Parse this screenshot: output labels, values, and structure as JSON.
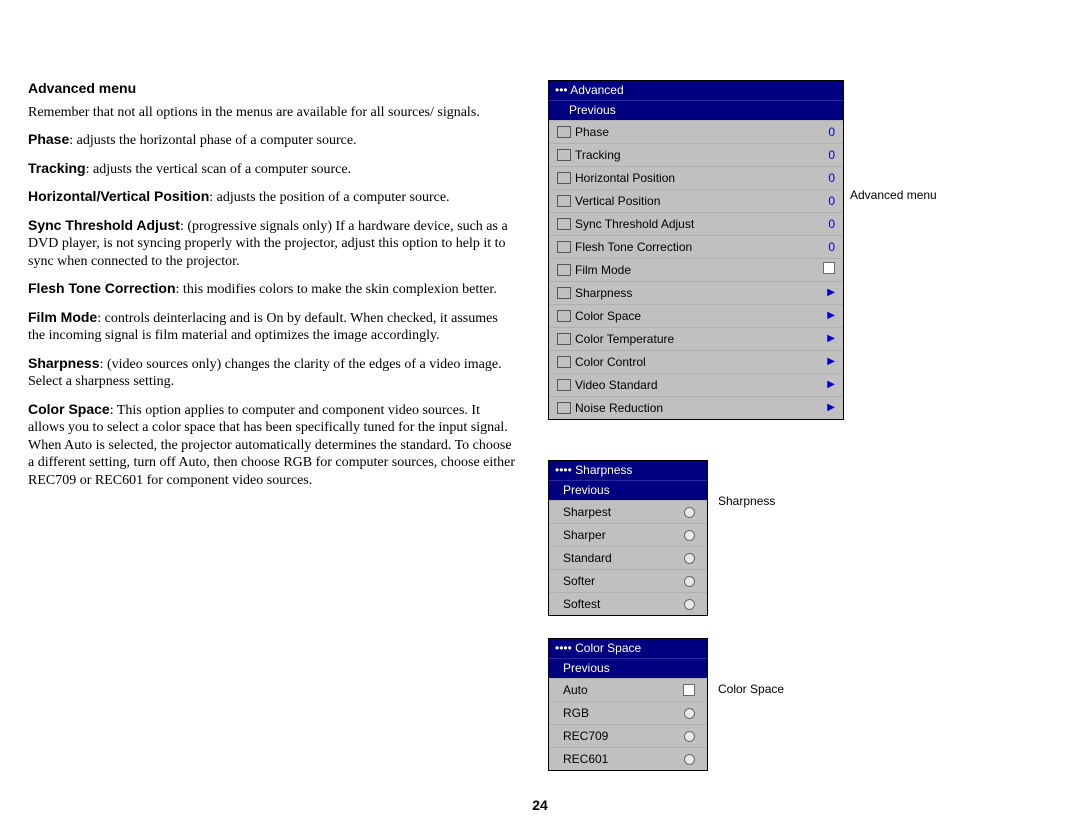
{
  "heading": "Advanced menu",
  "intro": "Remember that not all options in the menus are available for all sources/ signals.",
  "paras": [
    {
      "term": "Phase",
      "text": ": adjusts the horizontal phase of a computer source."
    },
    {
      "term": "Tracking",
      "text": ": adjusts the vertical scan of a computer source."
    },
    {
      "term": "Horizontal/Vertical Position",
      "text": ": adjusts the position of a computer source."
    },
    {
      "term": "Sync Threshold Adjust",
      "text": ": (progressive signals only) If a hardware device, such as a DVD player, is not syncing properly with the projector, adjust this option to help it to sync when connected to the projector."
    },
    {
      "term": "Flesh Tone Correction",
      "text": ": this modifies colors to make the skin complexion better."
    },
    {
      "term": "Film Mode",
      "text": ": controls deinterlacing and is On by default. When checked, it assumes the incoming signal is film material and optimizes the image accordingly."
    },
    {
      "term": "Sharpness",
      "text": ": (video sources only) changes the clarity of the edges of a video image. Select a sharpness setting."
    },
    {
      "term": "Color Space",
      "text": ": This option applies to computer and component video sources. It allows you to select a color space that has been specifically tuned for the input signal. When Auto is selected, the projector automatically determines the standard. To choose a different setting, turn off Auto, then choose RGB for computer sources, choose either REC709 or REC601 for component video sources."
    }
  ],
  "page_number": "24",
  "captions": {
    "adv": "Advanced menu",
    "sharp": "Sharpness",
    "cspace": "Color Space"
  },
  "advanced": {
    "title_prefix": "••• ",
    "title": "Advanced",
    "previous": "Previous",
    "rows": [
      {
        "icon": "phase-icon",
        "label": "Phase",
        "value": "0"
      },
      {
        "icon": "tracking-icon",
        "label": "Tracking",
        "value": "0"
      },
      {
        "icon": "hpos-icon",
        "label": "Horizontal Position",
        "value": "0"
      },
      {
        "icon": "vpos-icon",
        "label": "Vertical Position",
        "value": "0"
      },
      {
        "icon": "sync-icon",
        "label": "Sync Threshold Adjust",
        "value": "0"
      },
      {
        "icon": "flesh-icon",
        "label": "Flesh Tone Correction",
        "value": "0"
      },
      {
        "icon": "film-icon",
        "label": "Film Mode",
        "check": true
      },
      {
        "icon": "sharp-icon",
        "label": "Sharpness",
        "arrow": true
      },
      {
        "icon": "cspace-icon",
        "label": "Color Space",
        "arrow": true
      },
      {
        "icon": "ctemp-icon",
        "label": "Color Temperature",
        "arrow": true
      },
      {
        "icon": "cctrl-icon",
        "label": "Color Control",
        "arrow": true
      },
      {
        "icon": "vstd-icon",
        "label": "Video Standard",
        "arrow": true
      },
      {
        "icon": "noise-icon",
        "label": "Noise Reduction",
        "arrow": true
      }
    ]
  },
  "sharpness": {
    "title_prefix": "•••• ",
    "title": "Sharpness",
    "previous": "Previous",
    "rows": [
      {
        "label": "Sharpest"
      },
      {
        "label": "Sharper"
      },
      {
        "label": "Standard"
      },
      {
        "label": "Softer"
      },
      {
        "label": "Softest"
      }
    ]
  },
  "colorspace": {
    "title_prefix": "•••• ",
    "title": "Color Space",
    "previous": "Previous",
    "rows": [
      {
        "label": "Auto",
        "check": true
      },
      {
        "label": "RGB"
      },
      {
        "label": "REC709"
      },
      {
        "label": "REC601"
      }
    ]
  }
}
